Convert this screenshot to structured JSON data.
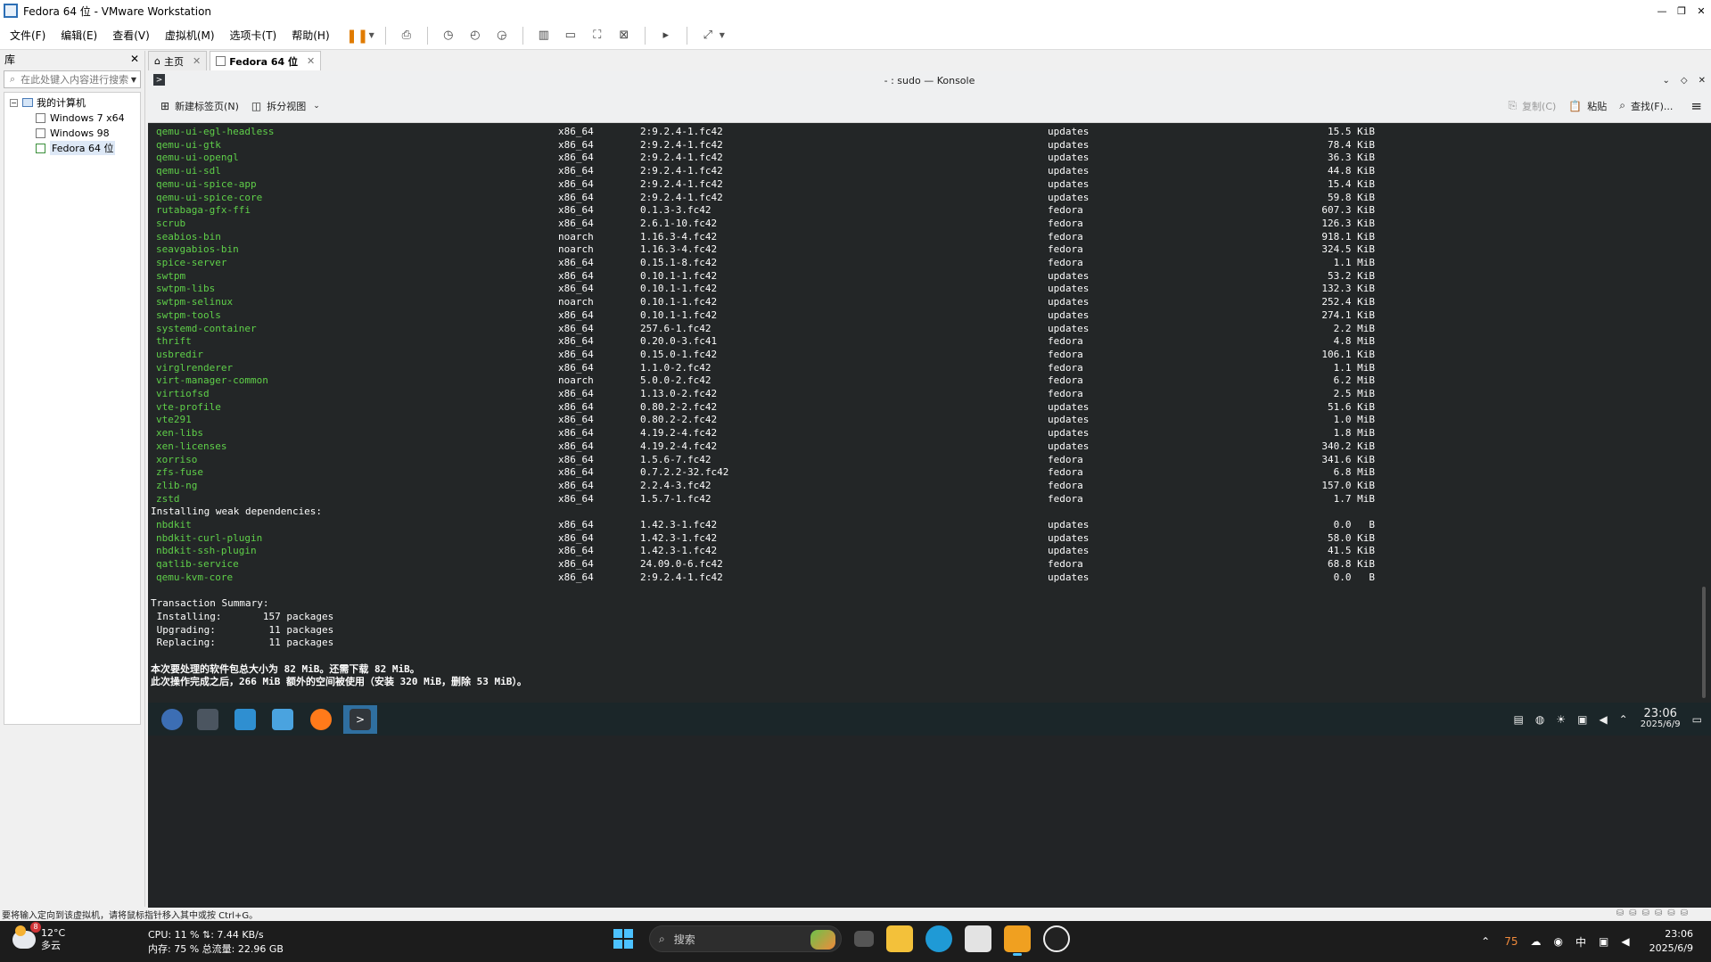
{
  "window": {
    "title": "Fedora 64 位 - VMware Workstation"
  },
  "menu": [
    "文件(F)",
    "编辑(E)",
    "查看(V)",
    "虚拟机(M)",
    "选项卡(T)",
    "帮助(H)"
  ],
  "library": {
    "title": "库",
    "search_placeholder": "在此处键入内容进行搜索",
    "root": "我的计算机",
    "vms": [
      "Windows 7 x64",
      "Windows 98",
      "Fedora 64 位"
    ]
  },
  "tabs": [
    {
      "label": "主页"
    },
    {
      "label": "Fedora 64 位"
    }
  ],
  "konsole": {
    "title": "- : sudo — Konsole",
    "new_tab": "新建标签页(N)",
    "split_view": "拆分视图",
    "copy": "复制(C)",
    "paste": "粘贴",
    "find": "查找(F)..."
  },
  "packages": [
    [
      "qemu-ui-egl-headless",
      "x86_64",
      "2:9.2.4-1.fc42",
      "updates",
      "15.5 KiB"
    ],
    [
      "qemu-ui-gtk",
      "x86_64",
      "2:9.2.4-1.fc42",
      "updates",
      "78.4 KiB"
    ],
    [
      "qemu-ui-opengl",
      "x86_64",
      "2:9.2.4-1.fc42",
      "updates",
      "36.3 KiB"
    ],
    [
      "qemu-ui-sdl",
      "x86_64",
      "2:9.2.4-1.fc42",
      "updates",
      "44.8 KiB"
    ],
    [
      "qemu-ui-spice-app",
      "x86_64",
      "2:9.2.4-1.fc42",
      "updates",
      "15.4 KiB"
    ],
    [
      "qemu-ui-spice-core",
      "x86_64",
      "2:9.2.4-1.fc42",
      "updates",
      "59.8 KiB"
    ],
    [
      "rutabaga-gfx-ffi",
      "x86_64",
      "0.1.3-3.fc42",
      "fedora",
      "607.3 KiB"
    ],
    [
      "scrub",
      "x86_64",
      "2.6.1-10.fc42",
      "fedora",
      "126.3 KiB"
    ],
    [
      "seabios-bin",
      "noarch",
      "1.16.3-4.fc42",
      "fedora",
      "918.1 KiB"
    ],
    [
      "seavgabios-bin",
      "noarch",
      "1.16.3-4.fc42",
      "fedora",
      "324.5 KiB"
    ],
    [
      "spice-server",
      "x86_64",
      "0.15.1-8.fc42",
      "fedora",
      "1.1 MiB"
    ],
    [
      "swtpm",
      "x86_64",
      "0.10.1-1.fc42",
      "updates",
      "53.2 KiB"
    ],
    [
      "swtpm-libs",
      "x86_64",
      "0.10.1-1.fc42",
      "updates",
      "132.3 KiB"
    ],
    [
      "swtpm-selinux",
      "noarch",
      "0.10.1-1.fc42",
      "updates",
      "252.4 KiB"
    ],
    [
      "swtpm-tools",
      "x86_64",
      "0.10.1-1.fc42",
      "updates",
      "274.1 KiB"
    ],
    [
      "systemd-container",
      "x86_64",
      "257.6-1.fc42",
      "updates",
      "2.2 MiB"
    ],
    [
      "thrift",
      "x86_64",
      "0.20.0-3.fc41",
      "fedora",
      "4.8 MiB"
    ],
    [
      "usbredir",
      "x86_64",
      "0.15.0-1.fc42",
      "fedora",
      "106.1 KiB"
    ],
    [
      "virglrenderer",
      "x86_64",
      "1.1.0-2.fc42",
      "fedora",
      "1.1 MiB"
    ],
    [
      "virt-manager-common",
      "noarch",
      "5.0.0-2.fc42",
      "fedora",
      "6.2 MiB"
    ],
    [
      "virtiofsd",
      "x86_64",
      "1.13.0-2.fc42",
      "fedora",
      "2.5 MiB"
    ],
    [
      "vte-profile",
      "x86_64",
      "0.80.2-2.fc42",
      "updates",
      "51.6 KiB"
    ],
    [
      "vte291",
      "x86_64",
      "0.80.2-2.fc42",
      "updates",
      "1.0 MiB"
    ],
    [
      "xen-libs",
      "x86_64",
      "4.19.2-4.fc42",
      "updates",
      "1.8 MiB"
    ],
    [
      "xen-licenses",
      "x86_64",
      "4.19.2-4.fc42",
      "updates",
      "340.2 KiB"
    ],
    [
      "xorriso",
      "x86_64",
      "1.5.6-7.fc42",
      "fedora",
      "341.6 KiB"
    ],
    [
      "zfs-fuse",
      "x86_64",
      "0.7.2.2-32.fc42",
      "fedora",
      "6.8 MiB"
    ],
    [
      "zlib-ng",
      "x86_64",
      "2.2.4-3.fc42",
      "fedora",
      "157.0 KiB"
    ],
    [
      "zstd",
      "x86_64",
      "1.5.7-1.fc42",
      "fedora",
      "1.7 MiB"
    ]
  ],
  "weak_header": "Installing weak dependencies:",
  "weak_packages": [
    [
      "nbdkit",
      "x86_64",
      "1.42.3-1.fc42",
      "updates",
      "0.0   B"
    ],
    [
      "nbdkit-curl-plugin",
      "x86_64",
      "1.42.3-1.fc42",
      "updates",
      "58.0 KiB"
    ],
    [
      "nbdkit-ssh-plugin",
      "x86_64",
      "1.42.3-1.fc42",
      "updates",
      "41.5 KiB"
    ],
    [
      "qatlib-service",
      "x86_64",
      "24.09.0-6.fc42",
      "fedora",
      "68.8 KiB"
    ],
    [
      "qemu-kvm-core",
      "x86_64",
      "2:9.2.4-1.fc42",
      "updates",
      "0.0   B"
    ]
  ],
  "summary": {
    "header": "Transaction Summary:",
    "lines": [
      " Installing:       157 packages",
      " Upgrading:         11 packages",
      " Replacing:         11 packages"
    ],
    "cn1": "本次要处理的软件包总大小为 82 MiB。还需下载 82 MiB。",
    "cn2": "此次操作完成之后，266 MiB 额外的空间被使用（安装 320 MiB，删除 53 MiB）。"
  },
  "vm_tray": {
    "time": "23:06",
    "date": "2025/6/9"
  },
  "statusbar": "要将输入定向到该虚拟机，请将鼠标指针移入其中或按 Ctrl+G。",
  "host_taskbar": {
    "weather_badge": "8",
    "temp": "12°C",
    "cond": "多云",
    "cpu": "CPU: 11 %  ⇅: 7.44 KB/s",
    "mem": "内存: 75 %  总流量: 22.96 GB",
    "search": "搜索",
    "tray_num": "75",
    "ime": "中",
    "time": "23:06",
    "date": "2025/6/9"
  }
}
